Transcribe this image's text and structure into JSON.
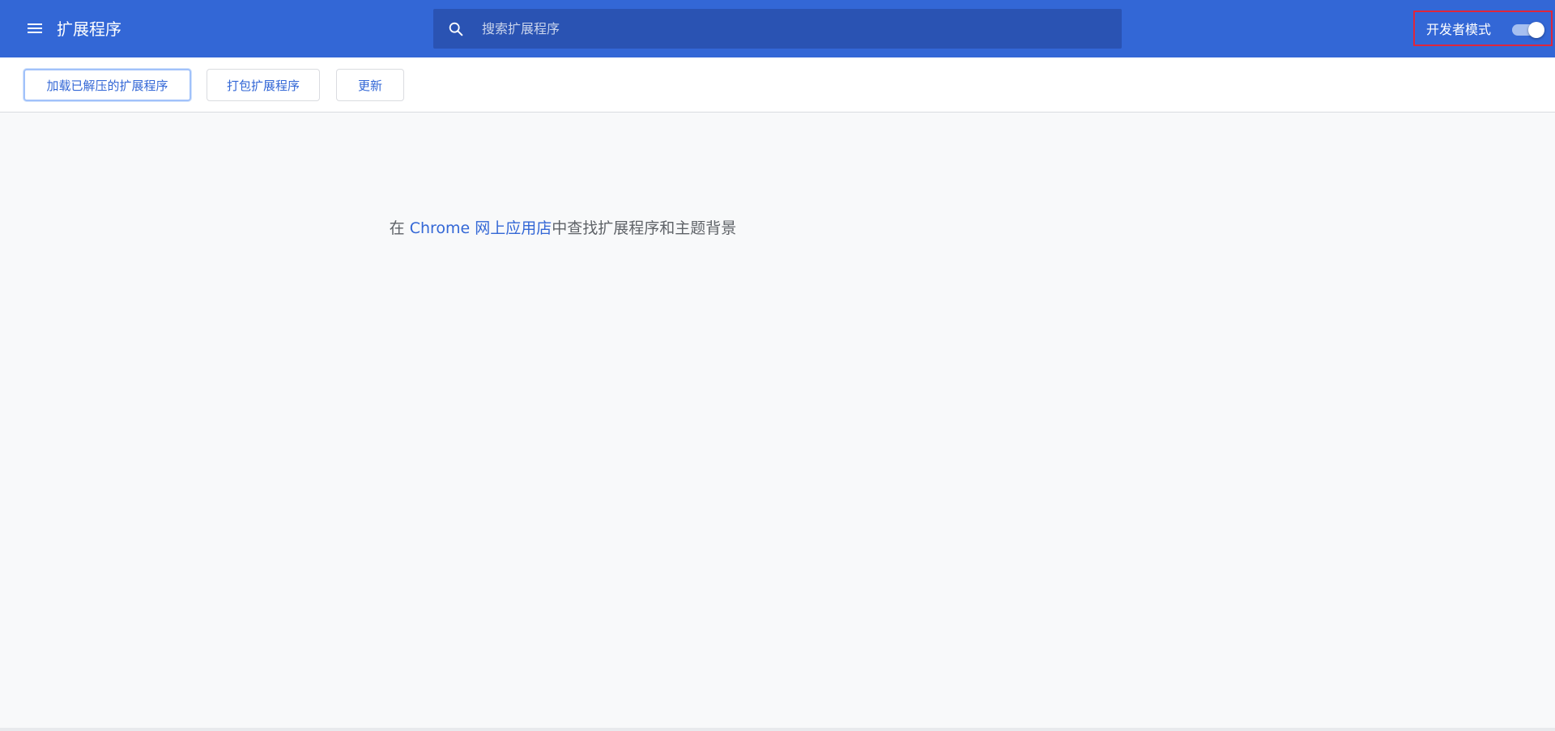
{
  "header": {
    "title": "扩展程序",
    "menu_icon": "hamburger-menu-icon",
    "background_color": "#3367d6"
  },
  "search": {
    "placeholder": "搜索扩展程序",
    "value": "",
    "icon": "search-icon"
  },
  "dev_mode": {
    "label": "开发者模式",
    "enabled": true,
    "highlight_color": "#e0263b"
  },
  "toolbar": {
    "load_unpacked_label": "加载已解压的扩展程序",
    "pack_label": "打包扩展程序",
    "update_label": "更新"
  },
  "empty_state": {
    "prefix": "在 ",
    "link_text": "Chrome 网上应用店",
    "suffix": "中查找扩展程序和主题背景"
  }
}
